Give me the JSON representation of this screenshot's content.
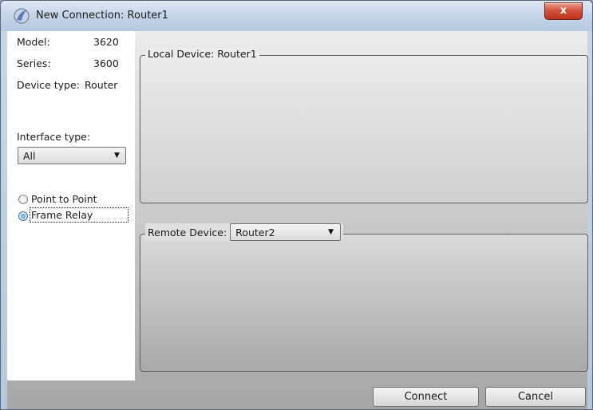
{
  "window": {
    "title": "New Connection: Router1",
    "close_label": "x"
  },
  "device_info": {
    "model_label": "Model:",
    "model_value": "3620",
    "series_label": "Series:",
    "series_value": "3600",
    "device_type_label": "Device type:",
    "device_type_value": "Router"
  },
  "interface": {
    "label": "Interface type:",
    "selected": "All"
  },
  "connection_type": {
    "options": [
      {
        "label": "Point to Point",
        "checked": false
      },
      {
        "label": "Frame Relay",
        "checked": true
      }
    ]
  },
  "local_device": {
    "legend": "Local Device: Router1"
  },
  "remote_device": {
    "legend": "Remote Device:",
    "selected": "Router2"
  },
  "buttons": {
    "connect": "Connect",
    "cancel": "Cancel"
  },
  "colors": {
    "title_bar": "#c6d6ea",
    "close_button": "#c0321b",
    "radio_checked": "#1e74c6"
  }
}
